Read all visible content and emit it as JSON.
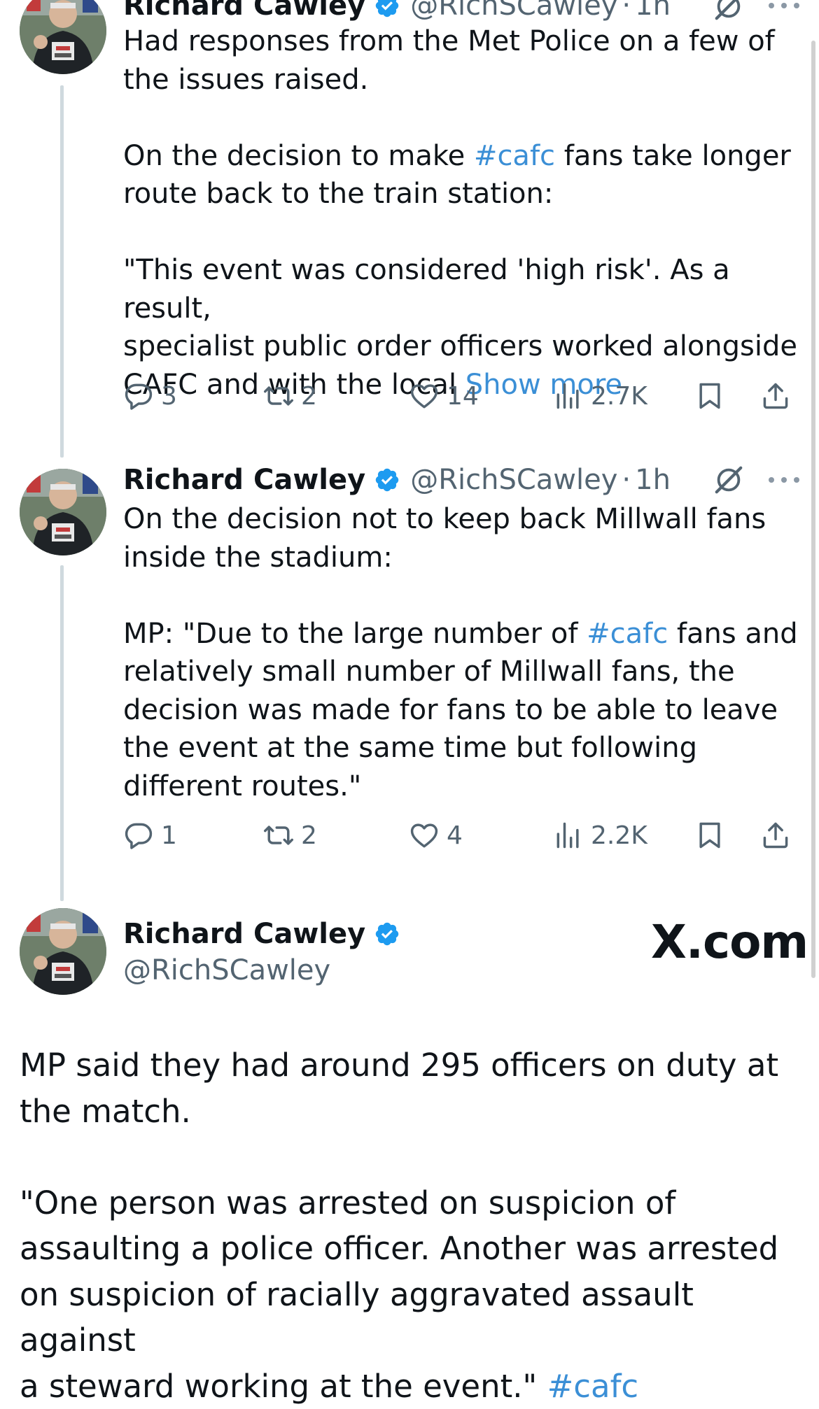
{
  "tweets": [
    {
      "name": "Richard Cawley",
      "handle": "@RichSCawley",
      "separator": "·",
      "time": "1h",
      "text_part1": "Had responses from the Met Police on a few of\nthe issues raised.\n\nOn the decision to make ",
      "hashtag1": "#cafc",
      "text_part2": " fans take longer\nroute back to the train station:\n\n\"This event was considered 'high risk'. As a result,\nspecialist public order officers worked alongside\nCAFC and with the local ",
      "show_more": "Show more",
      "replies": "3",
      "reposts": "2",
      "likes": "14",
      "views": "2.7K"
    },
    {
      "name": "Richard Cawley",
      "handle": "@RichSCawley",
      "separator": "·",
      "time": "1h",
      "text_part1": "On the decision not to keep back Millwall fans\ninside the stadium:\n\nMP: \"Due to the large number of ",
      "hashtag1": "#cafc",
      "text_part2": " fans and\nrelatively small number of Millwall fans, the\ndecision was made for fans to be able to leave\nthe event at the same time but following\ndifferent routes.\"",
      "replies": "1",
      "reposts": "2",
      "likes": "4",
      "views": "2.2K"
    },
    {
      "name": "Richard Cawley",
      "handle": "@RichSCawley",
      "site_label": "X.com",
      "text_part1": "MP said they had around 295 officers on duty at\nthe match.\n\n\"One person was arrested on suspicion of\nassaulting a police officer. Another was arrested\non suspicion of racially aggravated assault against\na steward working at the event.\" ",
      "hashtag1": "#cafc"
    }
  ],
  "colors": {
    "accent": "#3b8fd6",
    "verified": "#1d9bf0",
    "text": "#0f1419",
    "secondary": "#536471",
    "thread_line": "#cfd9de"
  },
  "icons": [
    "avatar-photo",
    "verified-badge-icon",
    "grok-icon",
    "more-icon",
    "reply-icon",
    "repost-icon",
    "like-icon",
    "views-icon",
    "bookmark-icon",
    "share-icon"
  ]
}
